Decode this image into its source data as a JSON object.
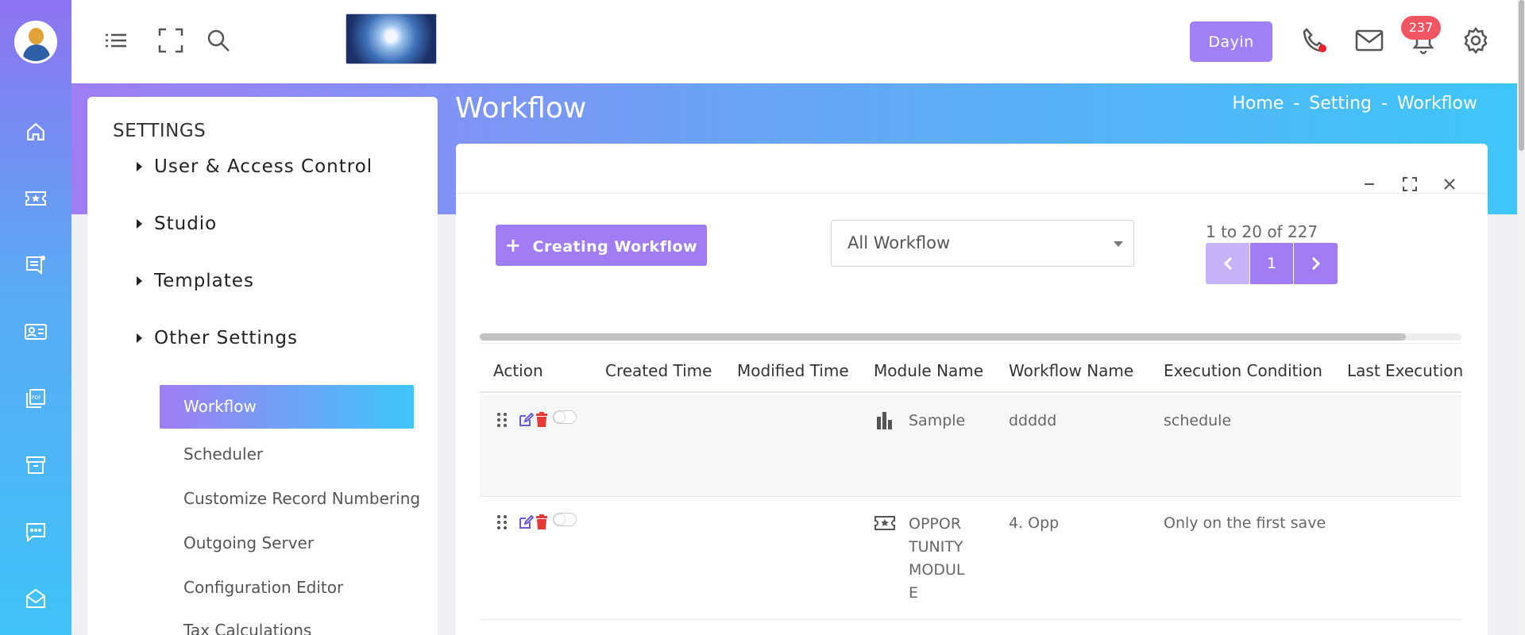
{
  "app": {
    "dayin_label": "Dayin",
    "notification_count": "237"
  },
  "page": {
    "title": "Workflow",
    "breadcrumb": [
      "Home",
      "-",
      "Setting",
      "-",
      "Workflow"
    ]
  },
  "settings": {
    "heading": "SETTINGS",
    "groups": [
      "User & Access Control",
      "Studio",
      "Templates",
      "Other Settings"
    ],
    "items": [
      "Workflow",
      "Scheduler",
      "Customize Record Numbering",
      "Outgoing Server",
      "Configuration Editor",
      "Tax Calculations"
    ]
  },
  "toolbar": {
    "create_label": "Creating Workflow",
    "filter_value": "All Workflow",
    "pager_text": "1 to 20 of 227",
    "current_page": "1"
  },
  "table": {
    "columns": [
      "Action",
      "Created Time",
      "Modified Time",
      "Module Name",
      "Workflow Name",
      "Execution Condition",
      "Last Execution"
    ],
    "rows": [
      {
        "module_icon": "bar-chart-icon",
        "module": "Sample",
        "workflow": "ddddd",
        "condition": "schedule"
      },
      {
        "module_icon": "ticket-star-icon",
        "module_lines": [
          "OPPOR",
          "TUNITY",
          "MODUL",
          "E"
        ],
        "workflow": "4. Opp",
        "condition": "Only on the first save"
      }
    ]
  },
  "icons": {
    "rail": [
      "home-icon",
      "ticket-star-icon",
      "news-icon",
      "contact-card-icon",
      "pdf-icon",
      "archive-icon",
      "chat-icon",
      "mail-open-icon"
    ],
    "topbar": [
      "list-icon",
      "fullscreen-icon",
      "search-icon",
      "phone-icon",
      "mail-icon",
      "bell-icon",
      "gear-icon"
    ]
  },
  "colors": {
    "accent": "#a07df4",
    "gradient_start": "#a07df4",
    "gradient_end": "#3ec6f9",
    "badge": "#f05562",
    "delete": "#e53935"
  }
}
